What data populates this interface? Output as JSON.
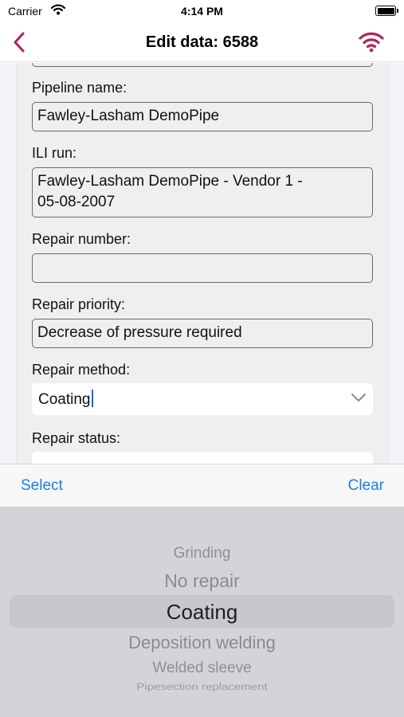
{
  "status_bar": {
    "carrier": "Carrier",
    "time": "4:14 PM"
  },
  "nav": {
    "title": "Edit data: 6588",
    "back_icon": "chevron-left-icon",
    "wifi_icon": "wifi-icon",
    "accent_color": "#b0245c"
  },
  "form": {
    "pipeline_name": {
      "label": "Pipeline name:",
      "value": "Fawley-Lasham DemoPipe"
    },
    "ili_run": {
      "label": "ILI run:",
      "value_line1": "Fawley-Lasham DemoPipe - Vendor 1 -",
      "value_line2": "05-08-2007"
    },
    "repair_number": {
      "label": "Repair number:",
      "value": ""
    },
    "repair_priority": {
      "label": "Repair priority:",
      "value": "Decrease of pressure required"
    },
    "repair_method": {
      "label": "Repair method:",
      "value": "Coating"
    },
    "repair_status": {
      "label": "Repair status:"
    }
  },
  "toolbar": {
    "select_label": "Select",
    "clear_label": "Clear",
    "accent_color": "#1a7fe6"
  },
  "picker": {
    "options": [
      "Grinding",
      "No repair",
      "Coating",
      "Deposition welding",
      "Welded sleeve",
      "Pipesection replacement"
    ],
    "selected": "Coating"
  }
}
